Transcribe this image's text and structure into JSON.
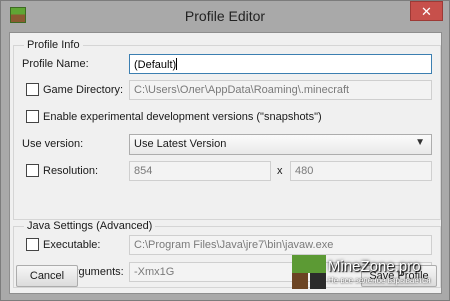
{
  "window": {
    "title": "Profile Editor",
    "close_glyph": "✕"
  },
  "colors": {
    "close_button": "#c7504b",
    "window_frame": "#a9a9a9"
  },
  "profile_info": {
    "group_title": "Profile Info",
    "profile_name_label": "Profile Name:",
    "profile_name_value": "(Default)",
    "game_directory_label": "Game Directory:",
    "game_directory_value": "C:\\Users\\Олег\\AppData\\Roaming\\.minecraft",
    "snapshots_label": "Enable experimental development versions (\"snapshots\")",
    "use_version_label": "Use version:",
    "use_version_value": "Use Latest Version",
    "resolution_label": "Resolution:",
    "resolution_width": "854",
    "resolution_x": "x",
    "resolution_height": "480"
  },
  "java_settings": {
    "group_title": "Java Settings (Advanced)",
    "executable_label": "Executable:",
    "executable_value": "C:\\Program Files\\Java\\jre7\\bin\\javaw.exe",
    "jvm_arguments_label": "JVM Arguments:",
    "jvm_arguments_value": "-Xmx1G"
  },
  "buttons": {
    "cancel": "Cancel",
    "save": "Save Profile"
  },
  "watermark": {
    "name": "MineZone.pro",
    "tagline": "Не все зеленое взрывается"
  }
}
